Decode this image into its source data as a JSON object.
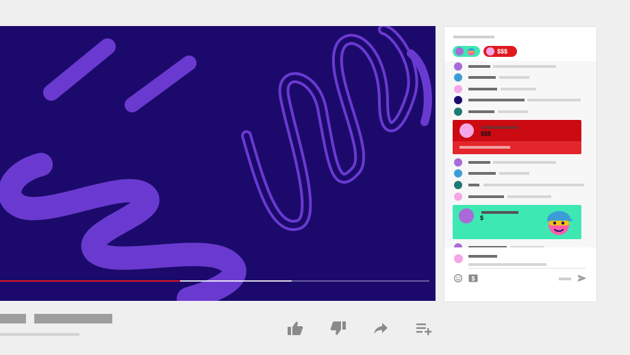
{
  "player": {
    "progress_played": 0.42,
    "progress_loaded": 0.68,
    "colors": {
      "background": "#1b0a6b",
      "strokes": "#6a3ad0",
      "played": "#e0191f"
    }
  },
  "actions": [
    {
      "name": "like-button",
      "icon": "thumbs-up-icon"
    },
    {
      "name": "dislike-button",
      "icon": "thumbs-down-icon"
    },
    {
      "name": "share-button",
      "icon": "share-arrow-icon"
    },
    {
      "name": "save-to-playlist-button",
      "icon": "playlist-add-icon"
    }
  ],
  "chat": {
    "filter_pills": [
      {
        "color": "#3ee8b3",
        "dot": "#a96ad9",
        "label": "",
        "icon": "character-face-icon"
      },
      {
        "color": "#e0191f",
        "dot": "#f5a6e6",
        "label": "$$$"
      }
    ],
    "messages_top": [
      {
        "avatar": "#a96ad9"
      },
      {
        "avatar": "#3d9cd8"
      },
      {
        "avatar": "#f5a6e6"
      },
      {
        "avatar": "#1b0a6b"
      },
      {
        "avatar": "#1d7a72"
      }
    ],
    "superchat_red": {
      "avatar": "#f5a6e6",
      "amount": "$$$",
      "color": "#cc0a12"
    },
    "messages_mid": [
      {
        "avatar": "#a96ad9"
      },
      {
        "avatar": "#3d9cd8"
      },
      {
        "avatar": "#1d7a72"
      },
      {
        "avatar": "#f5a6e6"
      }
    ],
    "superchat_green": {
      "avatar": "#a96ad9",
      "amount": "$",
      "color": "#3ee8b3"
    },
    "input": {
      "avatar": "#f5a6e6",
      "icons": [
        "emoji-icon",
        "superchat-dollar-icon",
        "send-icon"
      ]
    }
  }
}
